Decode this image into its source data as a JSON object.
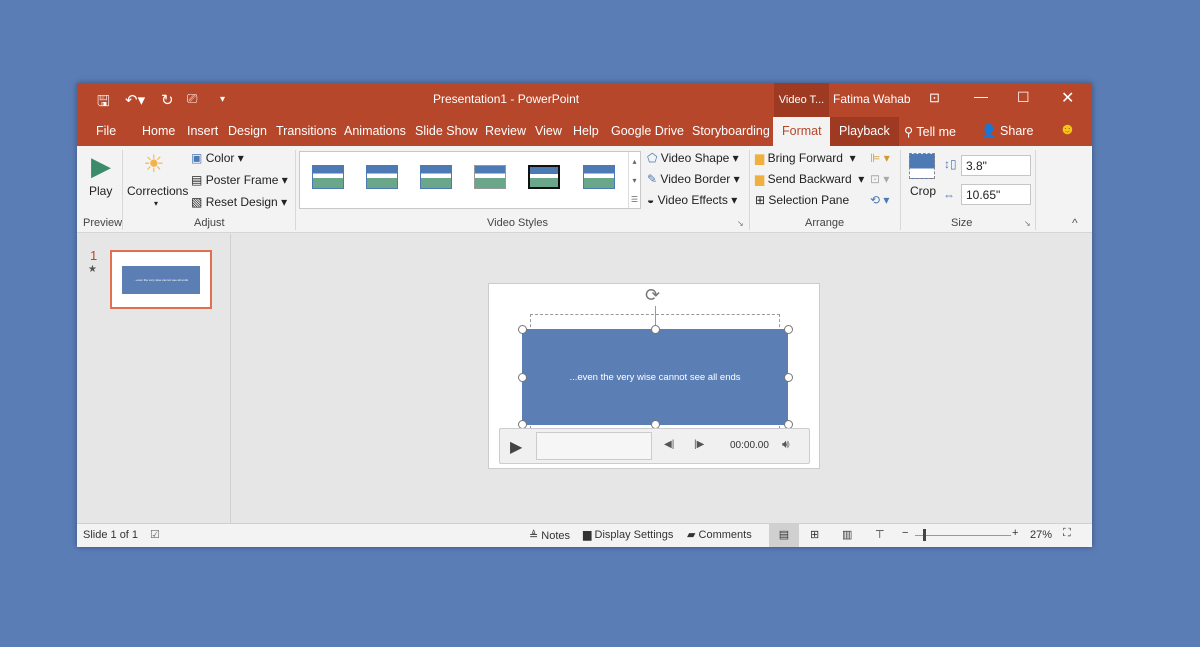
{
  "window": {
    "title": "Presentation1  -  PowerPoint",
    "context_tab": "Video T...",
    "user": "Fatima Wahab"
  },
  "tabs": [
    "File",
    "Home",
    "Insert",
    "Design",
    "Transitions",
    "Animations",
    "Slide Show",
    "Review",
    "View",
    "Help",
    "Google Drive",
    "Storyboarding",
    "Format",
    "Playback"
  ],
  "tell_me": "Tell me",
  "share": "Share",
  "ribbon": {
    "preview": {
      "play": "Play",
      "group": "Preview"
    },
    "adjust": {
      "corrections": "Corrections",
      "color": "Color",
      "poster_frame": "Poster Frame",
      "reset_design": "Reset Design",
      "group": "Adjust"
    },
    "video_styles": {
      "group": "Video Styles",
      "shape": "Video Shape",
      "border": "Video Border",
      "effects": "Video Effects"
    },
    "arrange": {
      "bring_forward": "Bring Forward",
      "send_backward": "Send Backward",
      "selection_pane": "Selection Pane",
      "group": "Arrange"
    },
    "size": {
      "crop": "Crop",
      "height": "3.8\"",
      "width": "10.65\"",
      "group": "Size"
    }
  },
  "thumbs": {
    "number": "1",
    "star": "★",
    "text": "...even the very wise cannot see all ends"
  },
  "slide": {
    "video_text": "...even the very wise cannot see all ends",
    "time": "00:00.00"
  },
  "status": {
    "slide": "Slide 1 of 1",
    "notes": "Notes",
    "display": "Display Settings",
    "comments": "Comments",
    "zoom": "27%"
  },
  "colors": {
    "accent": "#b7472a",
    "video": "#5b7fb5"
  }
}
